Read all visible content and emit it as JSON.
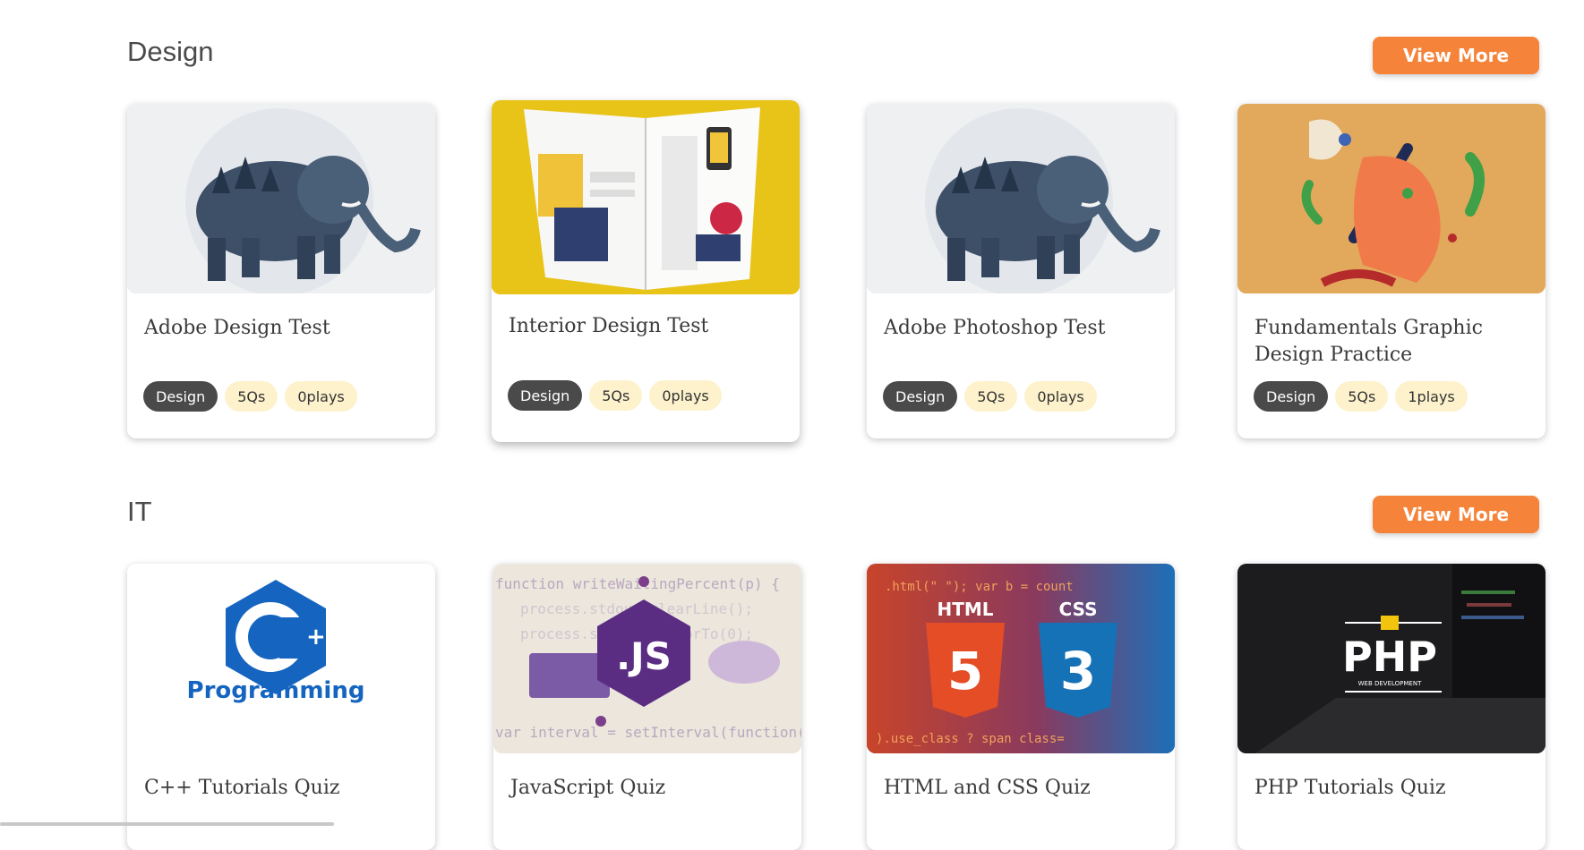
{
  "sections": [
    {
      "title": "Design",
      "view_more": "View More",
      "cards": [
        {
          "title": "Adobe Design Test",
          "category": "Design",
          "questions": "5Qs",
          "plays": "0plays"
        },
        {
          "title": "Interior Design Test",
          "category": "Design",
          "questions": "5Qs",
          "plays": "0plays"
        },
        {
          "title": "Adobe Photoshop Test",
          "category": "Design",
          "questions": "5Qs",
          "plays": "0plays"
        },
        {
          "title": "Fundamentals Graphic Design Practice",
          "category": "Design",
          "questions": "5Qs",
          "plays": "1plays"
        }
      ]
    },
    {
      "title": "IT",
      "view_more": "View More",
      "cards": [
        {
          "title": "C++ Tutorials Quiz",
          "thumb_text": "Programming"
        },
        {
          "title": "JavaScript Quiz",
          "thumb_text": ".JS"
        },
        {
          "title": "HTML and CSS Quiz",
          "thumb_text": [
            "HTML",
            "CSS"
          ]
        },
        {
          "title": "PHP Tutorials Quiz",
          "thumb_text": [
            "PHP",
            "WEB DEVELOPMENT"
          ]
        }
      ]
    }
  ],
  "colors": {
    "accent": "#f5843a",
    "tag_dark": "#4a4a4a",
    "tag_soft": "#fdf2cc"
  }
}
